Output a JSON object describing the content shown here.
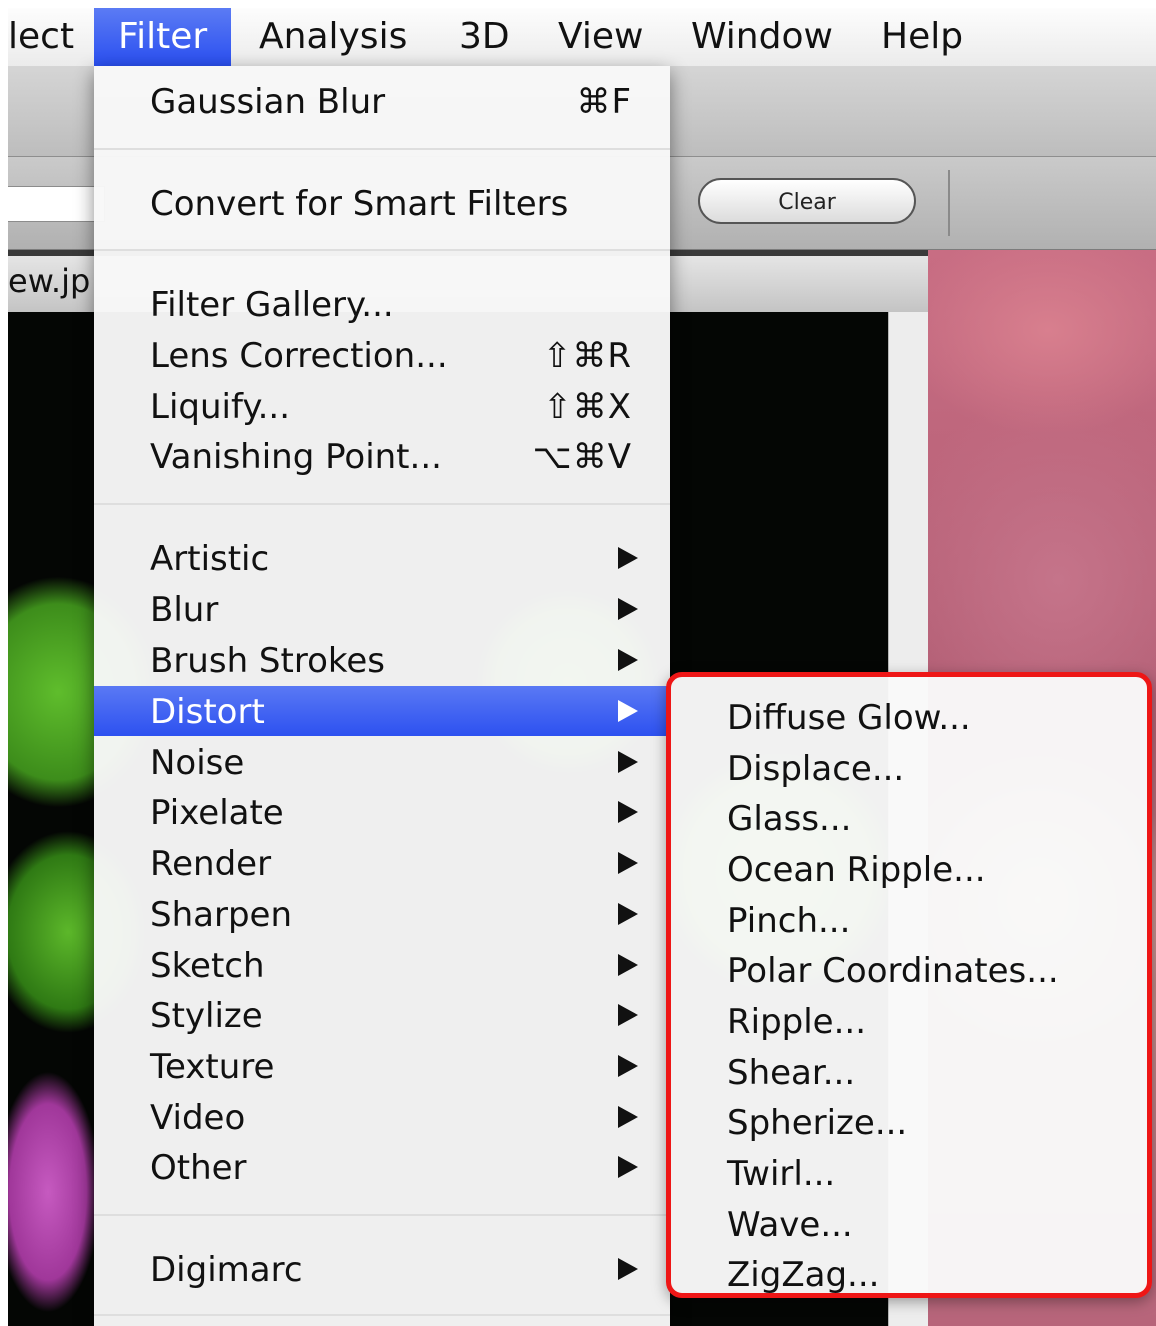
{
  "menubar": {
    "items": [
      {
        "label": "lect"
      },
      {
        "label": "Filter"
      },
      {
        "label": "Analysis"
      },
      {
        "label": "3D"
      },
      {
        "label": "View"
      },
      {
        "label": "Window"
      },
      {
        "label": "Help"
      }
    ]
  },
  "toolbar": {
    "clear_label": "Clear"
  },
  "document": {
    "title": "ew.jp"
  },
  "filter_menu": {
    "top": [
      {
        "label": "Gaussian Blur",
        "shortcut": "⌘F"
      },
      {
        "label": "Convert for Smart Filters"
      }
    ],
    "tools": [
      {
        "label": "Filter Gallery..."
      },
      {
        "label": "Lens Correction...",
        "shortcut": "⇧⌘R"
      },
      {
        "label": "Liquify...",
        "shortcut": "⇧⌘X"
      },
      {
        "label": "Vanishing Point...",
        "shortcut": "⌥⌘V"
      }
    ],
    "categories": [
      {
        "label": "Artistic"
      },
      {
        "label": "Blur"
      },
      {
        "label": "Brush Strokes"
      },
      {
        "label": "Distort",
        "highlighted": true
      },
      {
        "label": "Noise"
      },
      {
        "label": "Pixelate"
      },
      {
        "label": "Render"
      },
      {
        "label": "Sharpen"
      },
      {
        "label": "Sketch"
      },
      {
        "label": "Stylize"
      },
      {
        "label": "Texture"
      },
      {
        "label": "Video"
      },
      {
        "label": "Other"
      }
    ],
    "plugins": [
      {
        "label": "Digimarc"
      }
    ]
  },
  "distort_submenu": {
    "items": [
      {
        "label": "Diffuse Glow..."
      },
      {
        "label": "Displace..."
      },
      {
        "label": "Glass..."
      },
      {
        "label": "Ocean Ripple..."
      },
      {
        "label": "Pinch..."
      },
      {
        "label": "Polar Coordinates..."
      },
      {
        "label": "Ripple..."
      },
      {
        "label": "Shear..."
      },
      {
        "label": "Spherize..."
      },
      {
        "label": "Twirl..."
      },
      {
        "label": "Wave..."
      },
      {
        "label": "ZigZag..."
      }
    ],
    "highlight_color": "#ee1616"
  },
  "colors": {
    "menu_highlight": "#2d51f0",
    "annotation_border": "#ee1616"
  }
}
